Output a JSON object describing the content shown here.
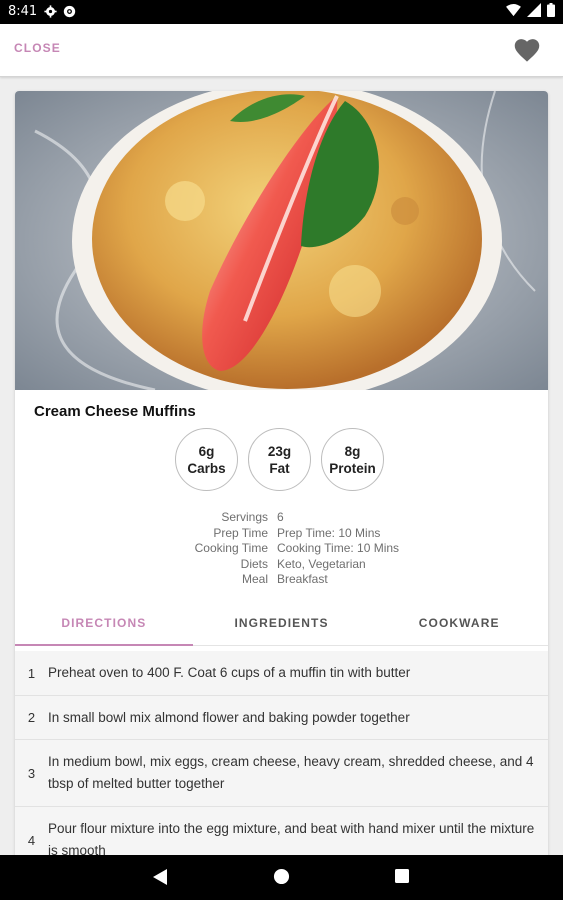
{
  "status_bar": {
    "time": "8:41",
    "icons": [
      "gear-icon",
      "at-sign-icon",
      "sync-icon",
      "wifi-icon",
      "signal-icon",
      "battery-icon"
    ]
  },
  "app_bar": {
    "close_label": "CLOSE",
    "favorite_icon": "heart-icon",
    "accent_color": "#c687b5"
  },
  "recipe": {
    "image": "muffin-with-strawberry-and-basil-photo",
    "title": "Cream Cheese Muffins",
    "macros": [
      {
        "value": "6g",
        "label": "Carbs"
      },
      {
        "value": "23g",
        "label": "Fat"
      },
      {
        "value": "8g",
        "label": "Protein"
      }
    ],
    "info": [
      {
        "key": "Servings",
        "value": "6"
      },
      {
        "key": "Prep Time",
        "value": "Prep Time: 10 Mins"
      },
      {
        "key": "Cooking Time",
        "value": "Cooking Time: 10 Mins"
      },
      {
        "key": "Diets",
        "value": "Keto, Vegetarian"
      },
      {
        "key": "Meal",
        "value": "Breakfast"
      }
    ]
  },
  "tabs": [
    {
      "label": "DIRECTIONS",
      "active": true
    },
    {
      "label": "INGREDIENTS",
      "active": false
    },
    {
      "label": "COOKWARE",
      "active": false
    }
  ],
  "directions": [
    {
      "number": "1",
      "text": "Preheat oven to 400 F. Coat 6 cups of a muffin tin with butter"
    },
    {
      "number": "2",
      "text": "In small bowl mix almond flower and baking powder together"
    },
    {
      "number": "3",
      "text": "In medium bowl, mix eggs, cream cheese, heavy cream, shredded cheese, and 4 tbsp of melted butter together"
    },
    {
      "number": "4",
      "text": "Pour flour mixture into the egg mixture, and beat with hand mixer until the mixture is smooth"
    }
  ],
  "nav_bar": {
    "icons": [
      "back-icon",
      "home-icon",
      "recents-icon"
    ]
  }
}
